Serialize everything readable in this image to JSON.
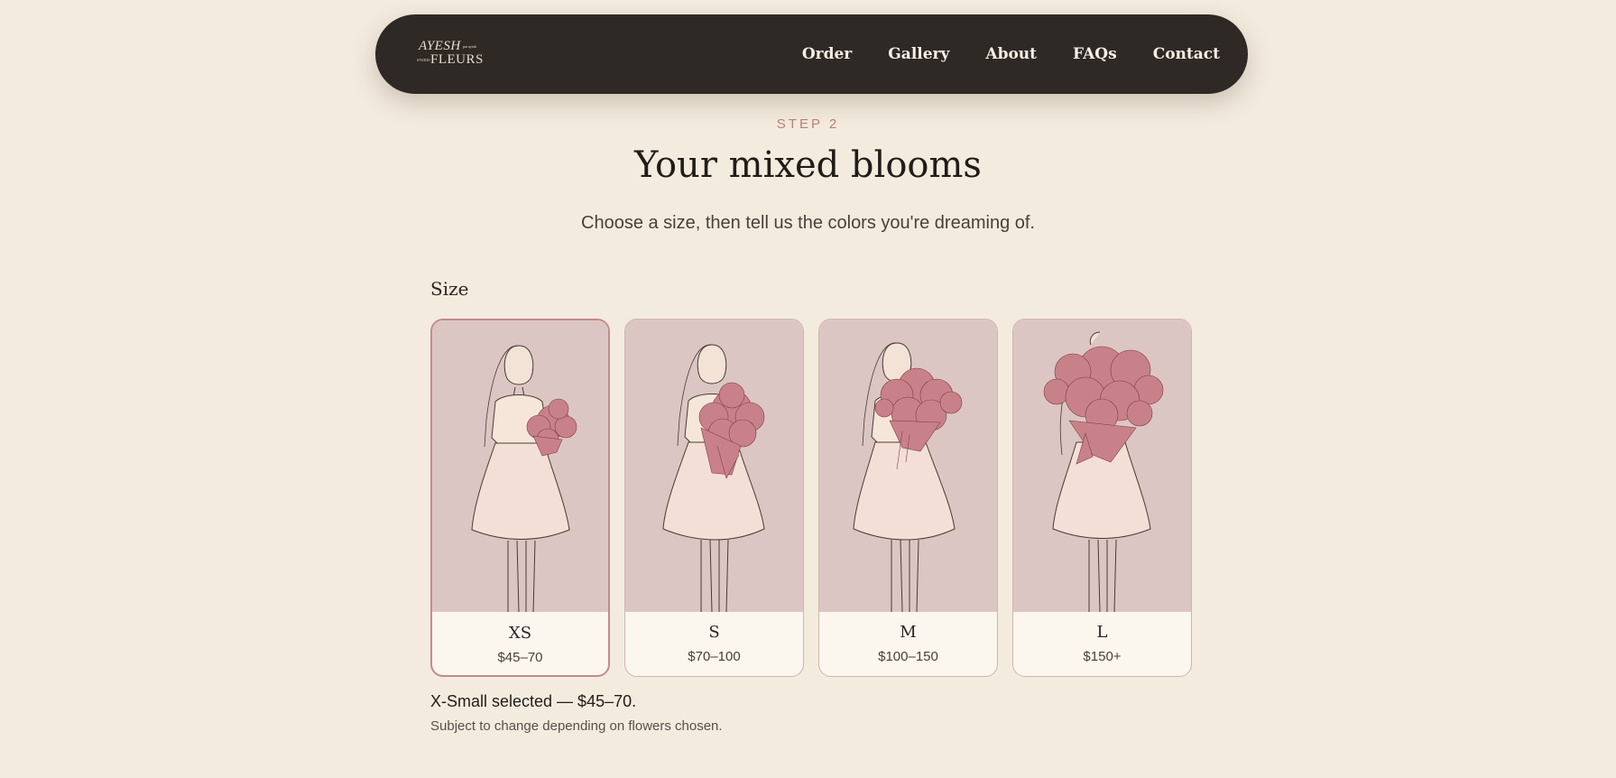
{
  "brand": {
    "line1": "AYESH",
    "line2": "FLEURS",
    "small1": "par ayesh",
    "small2": "STUDIO"
  },
  "nav": {
    "items": [
      "Order",
      "Gallery",
      "About",
      "FAQs",
      "Contact"
    ]
  },
  "step": {
    "label": "STEP 2",
    "title": "Your mixed blooms",
    "subtitle": "Choose a size, then tell us the colors you're dreaming of."
  },
  "size": {
    "label": "Size",
    "options": [
      {
        "name": "XS",
        "price": "$45–70",
        "selected": true
      },
      {
        "name": "S",
        "price": "$70–100",
        "selected": false
      },
      {
        "name": "M",
        "price": "$100–150",
        "selected": false
      },
      {
        "name": "L",
        "price": "$150+",
        "selected": false
      }
    ],
    "selected_note": "X-Small selected — $45–70.",
    "sub_note": "Subject to change depending on flowers chosen."
  },
  "colors": {
    "accent": "#c48a8c",
    "nav_bg": "#2e2925",
    "page_bg": "#f4ebdf",
    "bouquet": "#c98189"
  }
}
